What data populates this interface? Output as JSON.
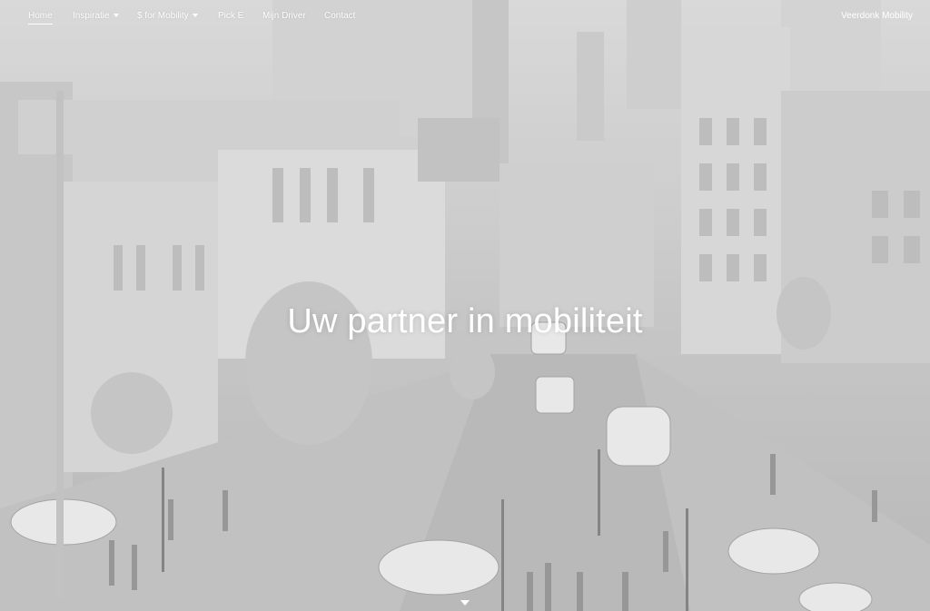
{
  "nav": {
    "items": [
      {
        "label": "Home",
        "has_dropdown": false,
        "active": true
      },
      {
        "label": "Inspiratie",
        "has_dropdown": true,
        "active": false
      },
      {
        "label": "$ for Mobility",
        "has_dropdown": true,
        "active": false
      },
      {
        "label": "Pick E",
        "has_dropdown": false,
        "active": false
      },
      {
        "label": "Mijn Driver",
        "has_dropdown": false,
        "active": false
      },
      {
        "label": "Contact",
        "has_dropdown": false,
        "active": false
      }
    ],
    "brand": "Veerdonk Mobility"
  },
  "hero": {
    "headline": "Uw partner in mobiliteit",
    "image_description_icon": "city-street-scene",
    "scroll_icon": "chevron-down-icon"
  },
  "colors": {
    "text": "#ffffff",
    "tint": "#c4c4c4"
  }
}
